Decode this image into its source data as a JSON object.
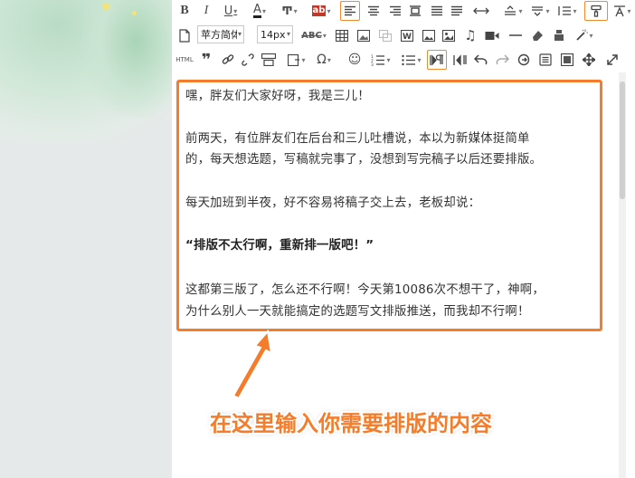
{
  "toolbar": {
    "font_family_value": "苹方简体",
    "font_size_value": "14px",
    "html_label": "HTML",
    "quote_label": "❞"
  },
  "editor": {
    "paragraphs": [
      {
        "text": "嘿，胖友们大家好呀，我是三儿！",
        "bold": false
      },
      {
        "text": "前两天，有位胖友们在后台和三儿吐槽说，本以为新媒体挺简单",
        "bold": false
      },
      {
        "text": "的，每天想选题，写稿就完事了，没想到写完稿子以后还要排版。",
        "bold": false
      },
      {
        "text": "每天加班到半夜，好不容易将稿子交上去，老板却说：",
        "bold": false
      },
      {
        "text": "“排版不太行啊，重新排一版吧！”",
        "bold": true
      },
      {
        "text": "这都第三版了，怎么还不行啊！今天第10086次不想干了，神啊，",
        "bold": false
      },
      {
        "text": "为什么别人一天就能搞定的选题写文排版推送，而我却不行啊！",
        "bold": false
      }
    ]
  },
  "annotation": {
    "callout_text": "在这里输入你需要排版的内容"
  },
  "colors": {
    "accent": "#f47c2a",
    "text": "#333333",
    "watercolor": "#b9dcc6"
  }
}
